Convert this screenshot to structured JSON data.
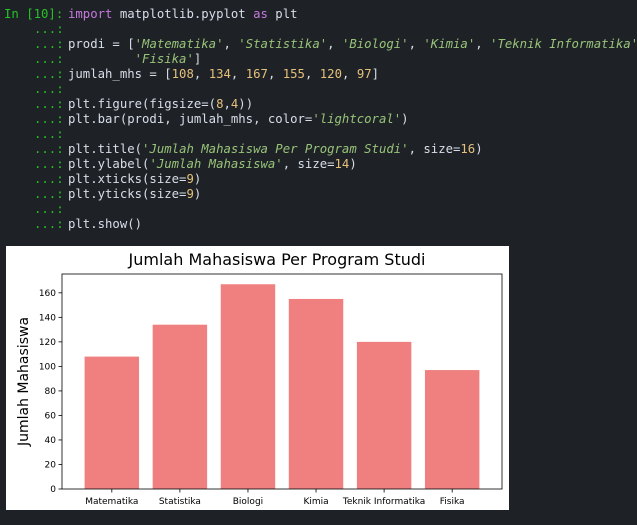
{
  "cell": {
    "prompt_in": "In [10]:",
    "continuation": "...:",
    "lines": [
      [
        {
          "t": "kw",
          "v": "import"
        },
        {
          "t": "plain",
          "v": " matplotlib.pyplot "
        },
        {
          "t": "kw",
          "v": "as"
        },
        {
          "t": "plain",
          "v": " plt"
        }
      ],
      [],
      [
        {
          "t": "plain",
          "v": "prodi = ["
        },
        {
          "t": "str",
          "v": "'Matematika'"
        },
        {
          "t": "plain",
          "v": ", "
        },
        {
          "t": "str",
          "v": "'Statistika'"
        },
        {
          "t": "plain",
          "v": ", "
        },
        {
          "t": "str",
          "v": "'Biologi'"
        },
        {
          "t": "plain",
          "v": ", "
        },
        {
          "t": "str",
          "v": "'Kimia'"
        },
        {
          "t": "plain",
          "v": ", "
        },
        {
          "t": "str",
          "v": "'Teknik Informatika'"
        },
        {
          "t": "plain",
          "v": ","
        }
      ],
      [
        {
          "t": "plain",
          "v": "         "
        },
        {
          "t": "str",
          "v": "'Fisika'"
        },
        {
          "t": "plain",
          "v": "]"
        }
      ],
      [
        {
          "t": "plain",
          "v": "jumlah_mhs = ["
        },
        {
          "t": "num",
          "v": "108"
        },
        {
          "t": "plain",
          "v": ", "
        },
        {
          "t": "num",
          "v": "134"
        },
        {
          "t": "plain",
          "v": ", "
        },
        {
          "t": "num",
          "v": "167"
        },
        {
          "t": "plain",
          "v": ", "
        },
        {
          "t": "num",
          "v": "155"
        },
        {
          "t": "plain",
          "v": ", "
        },
        {
          "t": "num",
          "v": "120"
        },
        {
          "t": "plain",
          "v": ", "
        },
        {
          "t": "num",
          "v": "97"
        },
        {
          "t": "plain",
          "v": "]"
        }
      ],
      [],
      [
        {
          "t": "plain",
          "v": "plt.figure(figsize=("
        },
        {
          "t": "num",
          "v": "8"
        },
        {
          "t": "plain",
          "v": ","
        },
        {
          "t": "num",
          "v": "4"
        },
        {
          "t": "plain",
          "v": "))"
        }
      ],
      [
        {
          "t": "plain",
          "v": "plt.bar(prodi, jumlah_mhs, color="
        },
        {
          "t": "str",
          "v": "'lightcoral'"
        },
        {
          "t": "plain",
          "v": ")"
        }
      ],
      [],
      [
        {
          "t": "plain",
          "v": "plt.title("
        },
        {
          "t": "str",
          "v": "'Jumlah Mahasiswa Per Program Studi'"
        },
        {
          "t": "plain",
          "v": ", size="
        },
        {
          "t": "num",
          "v": "16"
        },
        {
          "t": "plain",
          "v": ")"
        }
      ],
      [
        {
          "t": "plain",
          "v": "plt.ylabel("
        },
        {
          "t": "str",
          "v": "'Jumlah Mahasiswa'"
        },
        {
          "t": "plain",
          "v": ", size="
        },
        {
          "t": "num",
          "v": "14"
        },
        {
          "t": "plain",
          "v": ")"
        }
      ],
      [
        {
          "t": "plain",
          "v": "plt.xticks(size="
        },
        {
          "t": "num",
          "v": "9"
        },
        {
          "t": "plain",
          "v": ")"
        }
      ],
      [
        {
          "t": "plain",
          "v": "plt.yticks(size="
        },
        {
          "t": "num",
          "v": "9"
        },
        {
          "t": "plain",
          "v": ")"
        }
      ],
      [],
      [
        {
          "t": "plain",
          "v": "plt.show()"
        }
      ]
    ]
  },
  "chart_data": {
    "type": "bar",
    "title": "Jumlah Mahasiswa Per Program Studi",
    "xlabel": "",
    "ylabel": "Jumlah Mahasiswa",
    "categories": [
      "Matematika",
      "Statistika",
      "Biologi",
      "Kimia",
      "Teknik Informatika",
      "Fisika"
    ],
    "values": [
      108,
      134,
      167,
      155,
      120,
      97
    ],
    "yticks": [
      0,
      20,
      40,
      60,
      80,
      100,
      120,
      140,
      160
    ],
    "ylim": [
      0,
      175.35
    ],
    "bar_color": "#f08080",
    "grid": false,
    "legend": "none"
  },
  "colors": {
    "background": "#1e2227",
    "prompt": "#25c225",
    "keyword": "#c678dd",
    "string": "#98c379",
    "number": "#e5c07b",
    "text": "#d8dee9"
  }
}
